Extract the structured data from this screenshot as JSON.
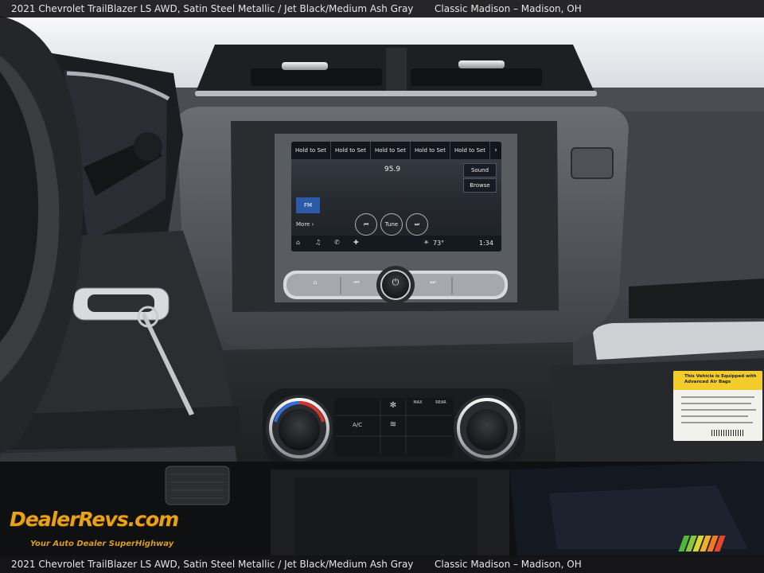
{
  "caption": {
    "top_left": "2021 Chevrolet TrailBlazer LS AWD,  Satin Steel Metallic / Jet Black/Medium Ash Gray",
    "top_right": "Classic Madison – Madison, OH",
    "bottom_left": "2021 Chevrolet TrailBlazer LS AWD,  Satin Steel Metallic / Jet Black/Medium Ash Gray",
    "bottom_right": "Classic Madison – Madison, OH"
  },
  "infotainment": {
    "presets": [
      "Hold to Set",
      "Hold to Set",
      "Hold to Set",
      "Hold to Set",
      "Hold to Set"
    ],
    "preset_arrow": "›",
    "frequency": "95.9",
    "sound_label": "Sound",
    "browse_label": "Browse",
    "band_label": "FM",
    "more_label": "More ›",
    "prev_label": "⏮",
    "tune_label": "Tune",
    "next_label": "⏭",
    "temperature": "73°",
    "clock": "1:34"
  },
  "controls": {
    "home_glyph": "⌂",
    "prev_glyph": "⏮",
    "power_glyph": "⏻",
    "next_glyph": "⏭",
    "ac_label": "A/C",
    "max_label": "MAX",
    "rear_label": "REAR"
  },
  "airbag_label": {
    "title": "This Vehicle is Equipped with Advanced Air Bags"
  },
  "watermark": {
    "brand": "DealerRevs.com",
    "tagline": "Your Auto Dealer SuperHighway"
  },
  "colors": {
    "caption_bg": "#141416",
    "fm_button": "#2c5aa8",
    "logo_orange": "#e8a21a",
    "label_yellow": "#f2cc2a",
    "hvac_blue": "#2f6fe0",
    "hvac_red": "#d8322a"
  },
  "icons": [
    "home-icon",
    "music-icon",
    "phone-icon",
    "apps-icon",
    "weather-icon",
    "power-icon",
    "fan-icon",
    "defrost-icon",
    "key-icon"
  ]
}
